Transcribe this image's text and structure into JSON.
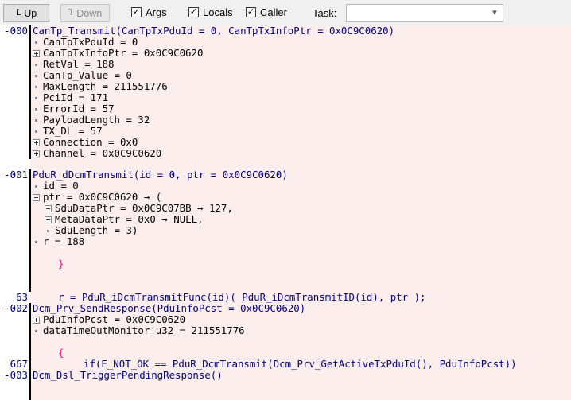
{
  "toolbar": {
    "up_label": "Up",
    "up_icon": "up-arrow-icon",
    "down_label": "Down",
    "down_icon": "down-arrow-icon",
    "args_label": "Args",
    "locals_label": "Locals",
    "caller_label": "Caller",
    "task_label": "Task:",
    "task_value": ""
  },
  "gutter": {
    "f0": "-000",
    "f1": "-001",
    "l63": "63",
    "f2": "-002",
    "l667": "667",
    "f3": "-003"
  },
  "frames": {
    "f0": {
      "header_fn": "CanTp_Transmit",
      "header_args": "(CanTpTxPduId = 0, CanTpTxInfoPtr = 0x0C9C0620)",
      "items": [
        "CanTpTxPduId = 0",
        "CanTpTxInfoPtr = 0x0C9C0620",
        "RetVal = 188",
        "CanTp_Value = 0",
        "MaxLength = 211551776",
        "PciId = 171",
        "ErrorId = 57",
        "PayloadLength = 32",
        "TX_DL = 57",
        "Connection = 0x0",
        "Channel = 0x0C9C0620"
      ]
    },
    "f1": {
      "header_fn": "PduR_dDcmTransmit",
      "header_args": "(id = 0, ptr = 0x0C9C0620)",
      "items": [
        "id = 0",
        "ptr = 0x0C9C0620 → (",
        "SduDataPtr = 0x0C9C07BB → 127,",
        "MetaDataPtr = 0x0 → NULL,",
        "SduLength = 3)",
        "r = 188"
      ],
      "brace_close": "}",
      "source_line": "r = PduR_iDcmTransmitFunc(id)( PduR_iDcmTransmitID(id), ptr );"
    },
    "f2": {
      "header_fn": "Dcm_Prv_SendResponse",
      "header_args": "(PduInfoPcst = 0x0C9C0620)",
      "items": [
        "PduInfoPcst = 0x0C9C0620",
        "dataTimeOutMonitor_u32 = 211551776"
      ],
      "brace_open": "{",
      "source_line": "if(E_NOT_OK == PduR_DcmTransmit(Dcm_Prv_GetActiveTxPduId(), PduInfoPcst))"
    },
    "f3": {
      "header_fn": "Dcm_Dsl_TriggerPendingResponse",
      "header_args": "()"
    }
  }
}
